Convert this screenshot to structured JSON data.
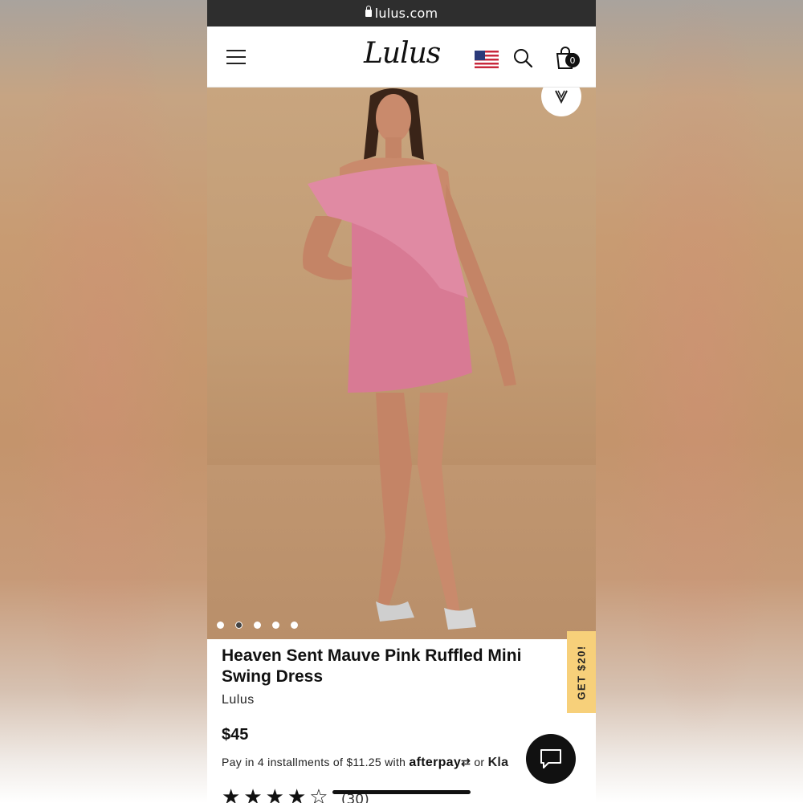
{
  "browser": {
    "url": "lulus.com"
  },
  "header": {
    "logo": "Lulus",
    "cart_count": "0"
  },
  "icons": {
    "menu": "hamburger-menu-icon",
    "flag": "us-flag-icon",
    "search": "search-icon",
    "bag": "shopping-bag-icon",
    "save": "heart-logo-icon",
    "chat": "chat-icon"
  },
  "gallery": {
    "dot_count": 5,
    "active_index": 1
  },
  "product": {
    "title": "Heaven Sent Mauve Pink Ruffled Mini Swing Dress",
    "brand": "Lulus",
    "price": "$45",
    "installments_text": "Pay in 4 installments of $11.25 with",
    "afterpay": "afterpay",
    "or": "or",
    "klarna": "Kla",
    "rating": 4,
    "review_count": "(30)"
  },
  "promo": {
    "label": "GET $20!"
  },
  "colors": {
    "promo_bg": "#f7d07a",
    "dress": "#d87a94",
    "backdrop": "#c29b73"
  }
}
